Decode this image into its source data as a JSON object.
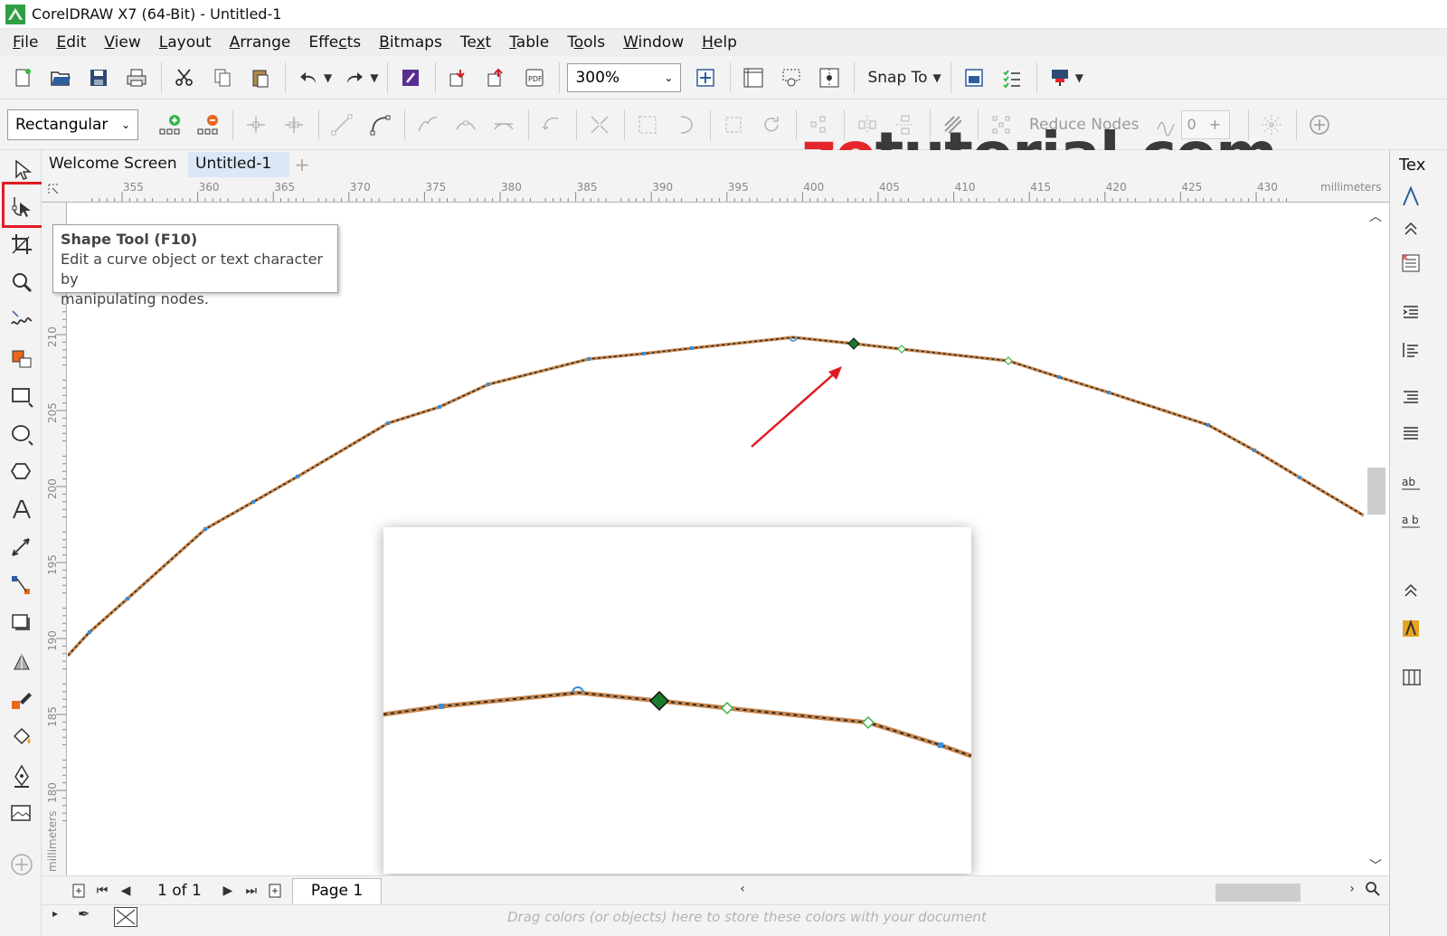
{
  "window": {
    "title": "CorelDRAW X7 (64-Bit) - Untitled-1"
  },
  "menu": [
    {
      "pre": "",
      "key": "F",
      "post": "ile"
    },
    {
      "pre": "",
      "key": "E",
      "post": "dit"
    },
    {
      "pre": "",
      "key": "V",
      "post": "iew"
    },
    {
      "pre": "",
      "key": "L",
      "post": "ayout"
    },
    {
      "pre": "",
      "key": "A",
      "post": "rrange"
    },
    {
      "pre": "Effe",
      "key": "c",
      "post": "ts"
    },
    {
      "pre": "",
      "key": "B",
      "post": "itmaps"
    },
    {
      "pre": "Te",
      "key": "x",
      "post": "t"
    },
    {
      "pre": "",
      "key": "T",
      "post": "able"
    },
    {
      "pre": "T",
      "key": "o",
      "post": "ols"
    },
    {
      "pre": "",
      "key": "W",
      "post": "indow"
    },
    {
      "pre": "",
      "key": "H",
      "post": "elp"
    }
  ],
  "toolbar": {
    "zoom_value": "300%",
    "snap_label": "Snap To"
  },
  "property_bar": {
    "selection_mode": "Rectangular",
    "reduce_nodes_label": "Reduce Nodes",
    "smoothness_value": "0"
  },
  "document_tabs": [
    {
      "label": "Welcome Screen",
      "active": false
    },
    {
      "label": "Untitled-1",
      "active": true
    }
  ],
  "rulers": {
    "top_ticks": [
      "355",
      "360",
      "365",
      "370",
      "375",
      "380",
      "385",
      "390",
      "395",
      "400",
      "405",
      "410",
      "415",
      "420",
      "425",
      "430"
    ],
    "top_units": "millimeters",
    "left_ticks": [
      "210",
      "205",
      "200",
      "195",
      "190",
      "185",
      "180"
    ],
    "left_units": "millimeters"
  },
  "tooltip": {
    "title": "Shape Tool (F10)",
    "description_line1": "Edit a curve object or text character by",
    "description_line2": "manipulating nodes."
  },
  "watermark": {
    "part_a": "zo",
    "part_b": "tutorial.com"
  },
  "page_nav": {
    "page_count": "1 of 1",
    "page_tab": "Page 1"
  },
  "palette": {
    "hint": "Drag colors (or objects) here to store these colors with your document"
  },
  "right_dock": {
    "label": "Tex"
  },
  "colors": {
    "accent_red": "#e11b22",
    "curve_outline": "#c8874d",
    "node_selected": "#1a7a2e",
    "node_default": "#3d8fd6",
    "tab_active_bg": "#dbe7f6"
  },
  "icons": {
    "active_tool": "shape-tool-icon"
  }
}
